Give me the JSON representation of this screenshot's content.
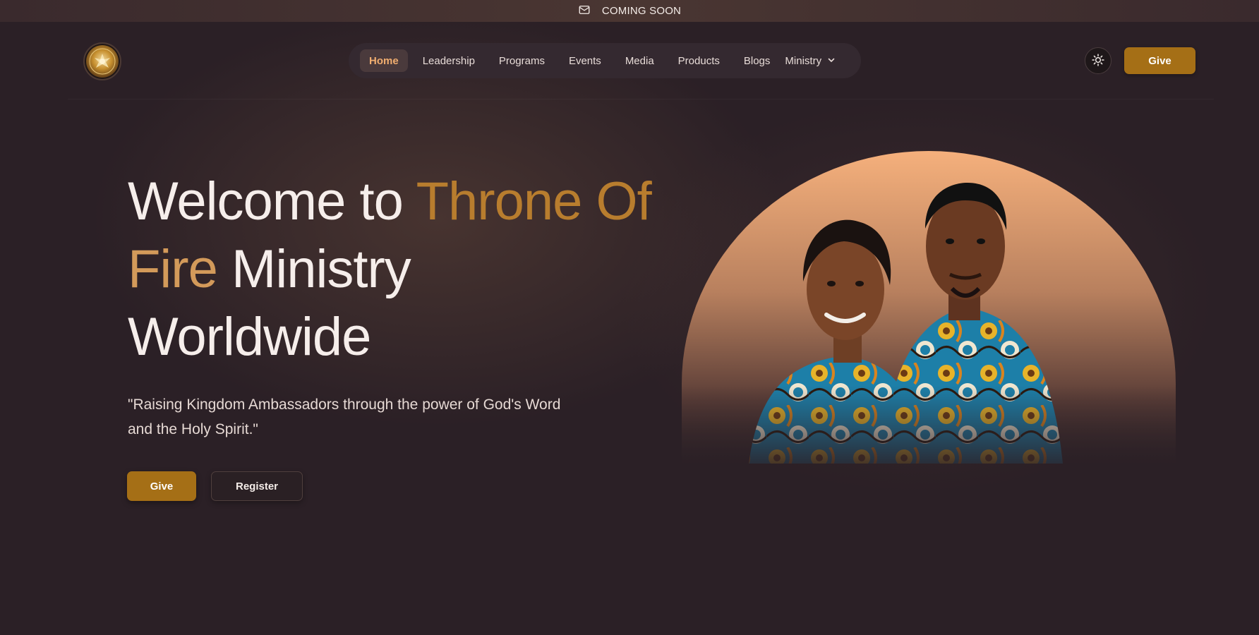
{
  "announcement": {
    "icon": "mail-icon",
    "text": "COMING SOON"
  },
  "header": {
    "logo_icon": "ministry-logo",
    "nav": [
      {
        "label": "Home",
        "active": true
      },
      {
        "label": "Leadership"
      },
      {
        "label": "Programs"
      },
      {
        "label": "Events"
      },
      {
        "label": "Media"
      },
      {
        "label": "Products"
      },
      {
        "label": "Blogs"
      },
      {
        "label": "Ministry",
        "dropdown": true
      }
    ],
    "theme_toggle_icon": "sun-icon",
    "give_label": "Give"
  },
  "hero": {
    "title_part1": "Welcome to ",
    "title_accent1": "Throne Of",
    "title_accent2": "Fire",
    "title_part2": " Ministry",
    "title_part3": "Worldwide",
    "tagline": "\"Raising Kingdom Ambassadors through the power of God's Word and the Holy Spirit.\"",
    "give_label": "Give",
    "register_label": "Register"
  },
  "colors": {
    "background": "#2b2026",
    "accent": "#a56f16",
    "title_accent": "#b87d2e",
    "nav_active": "#f0ad6f"
  }
}
